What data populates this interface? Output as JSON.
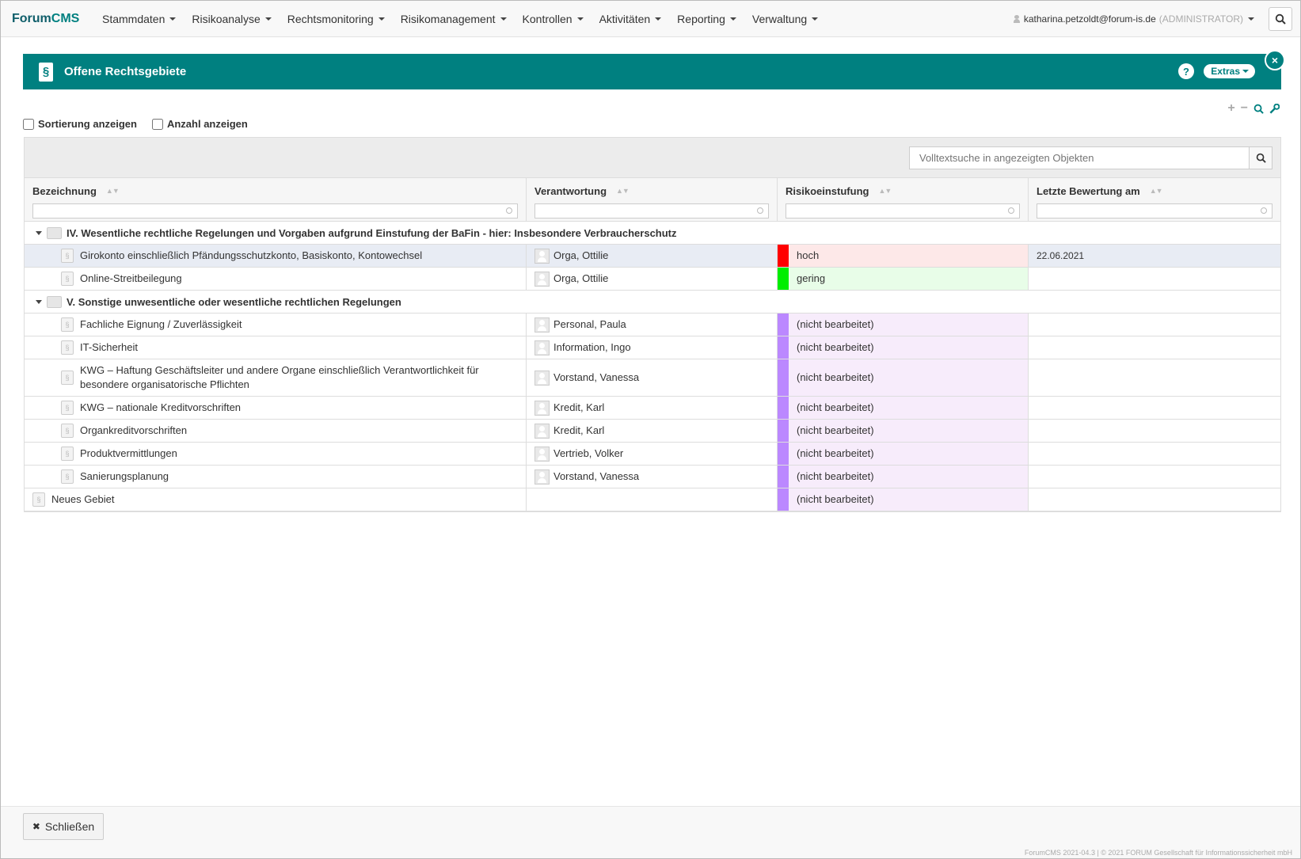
{
  "app": {
    "brand_a": "Forum",
    "brand_b": "CMS"
  },
  "nav": {
    "items": [
      "Stammdaten",
      "Risikoanalyse",
      "Rechtsmonitoring",
      "Risikomanagement",
      "Kontrollen",
      "Aktivitäten",
      "Reporting",
      "Verwaltung"
    ],
    "user": "katharina.petzoldt@forum-is.de",
    "role": "(ADMINISTRATOR)"
  },
  "panel": {
    "title": "Offene Rechtsgebiete",
    "help": "?",
    "extras": "Extras",
    "close": "×"
  },
  "options": {
    "show_sort": "Sortierung anzeigen",
    "show_count": "Anzahl anzeigen"
  },
  "search": {
    "placeholder": "Volltextsuche in angezeigten Objekten"
  },
  "columns": [
    "Bezeichnung",
    "Verantwortung",
    "Risikoeinstufung",
    "Letzte Bewertung am"
  ],
  "groups": [
    {
      "title": "IV. Wesentliche rechtliche Regelungen und Vorgaben aufgrund Einstufung der BaFin - hier: Insbesondere Verbraucherschutz",
      "rows": [
        {
          "name": "Girokonto einschließlich Pfändungsschutzkonto, Basiskonto, Kontowechsel",
          "owner": "Orga, Ottilie",
          "risk": "hoch",
          "risk_color": "#ff0000",
          "risk_bg": "#fde8e8",
          "date": "22.06.2021",
          "selected": true
        },
        {
          "name": "Online-Streitbeilegung",
          "owner": "Orga, Ottilie",
          "risk": "gering",
          "risk_color": "#00ee00",
          "risk_bg": "#e8fde8",
          "date": ""
        }
      ]
    },
    {
      "title": "V. Sonstige unwesentliche oder wesentliche rechtlichen Regelungen",
      "rows": [
        {
          "name": "Fachliche Eignung / Zuverlässigkeit",
          "owner": "Personal, Paula",
          "risk": "(nicht bearbeitet)",
          "risk_color": "#bb88ff",
          "risk_bg": "#f7ecfb",
          "date": ""
        },
        {
          "name": "IT-Sicherheit",
          "owner": "Information, Ingo",
          "risk": "(nicht bearbeitet)",
          "risk_color": "#bb88ff",
          "risk_bg": "#f7ecfb",
          "date": ""
        },
        {
          "name": "KWG – Haftung Geschäftsleiter und andere Organe einschließlich Verantwortlichkeit für besondere organisatorische Pflichten",
          "owner": "Vorstand, Vanessa",
          "risk": "(nicht bearbeitet)",
          "risk_color": "#bb88ff",
          "risk_bg": "#f7ecfb",
          "date": ""
        },
        {
          "name": "KWG – nationale Kreditvorschriften",
          "owner": "Kredit, Karl",
          "risk": "(nicht bearbeitet)",
          "risk_color": "#bb88ff",
          "risk_bg": "#f7ecfb",
          "date": ""
        },
        {
          "name": "Organkreditvorschriften",
          "owner": "Kredit, Karl",
          "risk": "(nicht bearbeitet)",
          "risk_color": "#bb88ff",
          "risk_bg": "#f7ecfb",
          "date": ""
        },
        {
          "name": "Produktvermittlungen",
          "owner": "Vertrieb, Volker",
          "risk": "(nicht bearbeitet)",
          "risk_color": "#bb88ff",
          "risk_bg": "#f7ecfb",
          "date": ""
        },
        {
          "name": "Sanierungsplanung",
          "owner": "Vorstand, Vanessa",
          "risk": "(nicht bearbeitet)",
          "risk_color": "#bb88ff",
          "risk_bg": "#f7ecfb",
          "date": ""
        }
      ]
    }
  ],
  "ungrouped": [
    {
      "name": "Neues Gebiet",
      "owner": "",
      "risk": "(nicht bearbeitet)",
      "risk_color": "#bb88ff",
      "risk_bg": "#f7ecfb",
      "date": ""
    }
  ],
  "footer": {
    "close_label": "Schließen",
    "copyright": "ForumCMS 2021-04.3 | © 2021 FORUM Gesellschaft für Informationssicherheit mbH"
  },
  "icons": {
    "search": "search-icon",
    "plus": "plus-icon",
    "minus": "minus-icon",
    "wrench": "wrench-icon",
    "folder": "folder-icon",
    "document": "document-icon",
    "person": "person-icon"
  }
}
